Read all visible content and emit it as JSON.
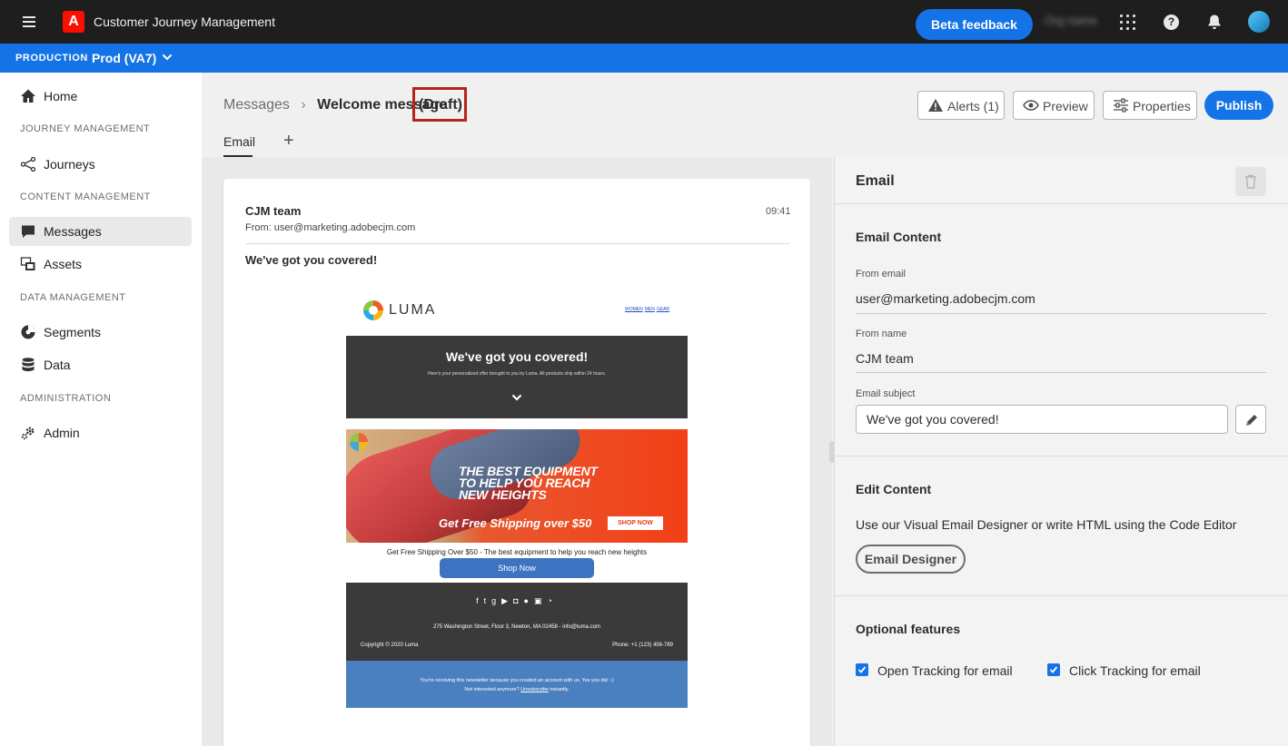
{
  "topbar": {
    "app_title": "Customer Journey Management",
    "logo_letter": "A",
    "beta_feedback": "Beta feedback",
    "org_name": "Org name",
    "help": "?"
  },
  "sandbox": {
    "label": "PRODUCTION",
    "name": "Prod (VA7)"
  },
  "nav": {
    "home": "Home",
    "sec_journey": "JOURNEY MANAGEMENT",
    "journeys": "Journeys",
    "sec_content": "CONTENT MANAGEMENT",
    "messages": "Messages",
    "assets": "Assets",
    "sec_data": "DATA MANAGEMENT",
    "segments": "Segments",
    "data": "Data",
    "sec_admin": "ADMINISTRATION",
    "admin": "Admin"
  },
  "header": {
    "breadcrumb_parent": "Messages",
    "breadcrumb_sep": "›",
    "title": "Welcome message",
    "status": "(Draft)",
    "alerts": "Alerts (1)",
    "preview": "Preview",
    "properties": "Properties",
    "publish": "Publish"
  },
  "tabs": {
    "email": "Email",
    "add": "+"
  },
  "mail": {
    "sender": "CJM team",
    "time": "09:41",
    "from": "From: user@marketing.adobecjm.com",
    "subject": "We've got you covered!",
    "brand": "LUMA",
    "nav_links": [
      "WOMEN",
      "MEN",
      "GEAR"
    ],
    "hero_title": "We've got you covered!",
    "hero_sub": "Here's your personalized offer brought to you by Luma. All products ship within 24 hours.",
    "banner_line1": "THE BEST EQUIPMENT",
    "banner_line2": "TO HELP YOU REACH",
    "banner_line3": "NEW HEIGHTS",
    "banner_shipping": "Get Free Shipping over $50",
    "banner_shop": "SHOP NOW",
    "promo": "Get Free Shipping Over $50 - The best equipment to help you reach new heights",
    "shop_now": "Shop Now",
    "social_icons": [
      "f",
      "t",
      "g+",
      "yt",
      "ig",
      "p",
      "in",
      "rss"
    ],
    "address": "275 Washington Street, Floor 3, Newton, MA 02458 - info@luma.com",
    "copyright": "Copyright © 2020 Luma",
    "phone": "Phone: +1 (123) 456-789",
    "footer_line1": "You're receiving this newsletter because you created an account with us. Yes you did :-)",
    "footer_line2_pre": "Not interested anymore?",
    "footer_unsub": "Unsubscribe",
    "footer_line2_post": "instantly."
  },
  "panel": {
    "title": "Email",
    "content_section": "Email Content",
    "from_email_label": "From email",
    "from_email": "user@marketing.adobecjm.com",
    "from_name_label": "From name",
    "from_name": "CJM team",
    "subject_label": "Email subject",
    "subject_value": "We've got you covered!",
    "edit_section": "Edit Content",
    "edit_desc": "Use our Visual Email Designer or write HTML using the Code Editor",
    "email_designer": "Email Designer",
    "optional_section": "Optional features",
    "open_tracking": "Open Tracking for email",
    "click_tracking": "Click Tracking for email"
  },
  "colors": {
    "brand_blue": "#1473e6",
    "topbar_bg": "#1e1e1e",
    "adobe_red": "#fa0f00",
    "draft_highlight": "#b3261e"
  },
  "icons": {
    "menu": "hamburger-icon",
    "grid": "apps-grid-icon",
    "help": "help-icon",
    "notifications": "bell-icon",
    "alert": "warning-icon",
    "preview": "eye-icon",
    "properties": "sliders-icon",
    "delete": "trash-icon",
    "edit": "pencil-icon"
  }
}
